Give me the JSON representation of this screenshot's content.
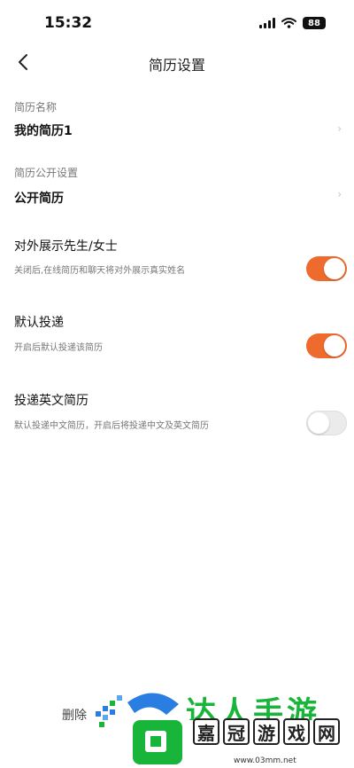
{
  "status_bar": {
    "time": "15:32",
    "battery": "88"
  },
  "nav": {
    "title": "简历设置"
  },
  "resume_name": {
    "label": "简历名称",
    "value": "我的简历1"
  },
  "resume_public": {
    "label": "简历公开设置",
    "value": "公开简历"
  },
  "toggles": [
    {
      "title": "对外展示先生/女士",
      "desc": "关闭后,在线简历和聊天将对外展示真实姓名",
      "state": "on"
    },
    {
      "title": "默认投递",
      "desc": "开启后默认投递该简历",
      "state": "on"
    },
    {
      "title": "投递英文简历",
      "desc": "默认投递中文简历，开启后将投递中文及英文简历",
      "state": "off"
    }
  ],
  "footer": {
    "delete_label": "删除"
  },
  "watermark": {
    "top_text": "达人手游",
    "cells": [
      "嘉",
      "冠",
      "游",
      "戏",
      "网"
    ],
    "url": "www.03mm.net"
  },
  "colors": {
    "accent": "#ee6a2d",
    "watermark_green": "#18b53a",
    "watermark_blue": "#2a7de1"
  }
}
